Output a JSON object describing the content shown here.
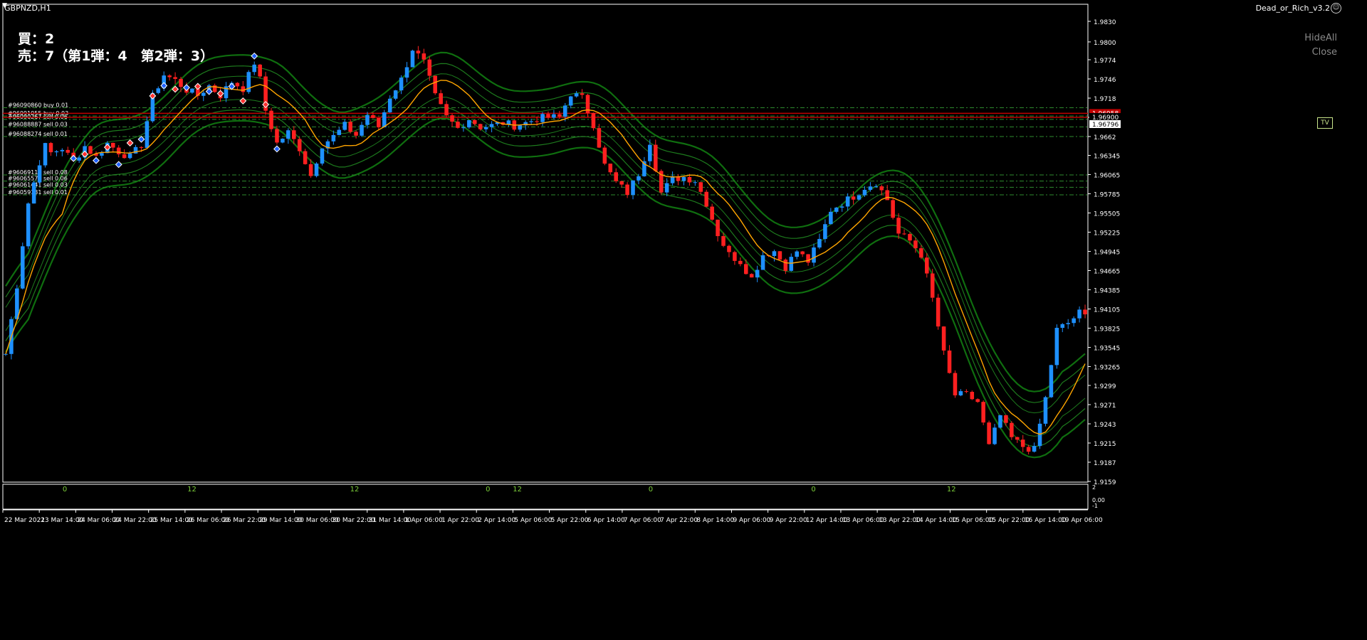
{
  "window": {
    "symbol_title": "GBPNZD,H1",
    "ea_title": "Dead_or_Rich_v3.2",
    "ea_icon": "☺"
  },
  "positions": {
    "buy_summary": "買：2",
    "sell_summary": "売：7（第1弾：4　第2弾：3）"
  },
  "buttons": {
    "hide_all": "HideAll",
    "close": "Close",
    "tv": "TV"
  },
  "chart_data": {
    "type": "candlestick",
    "symbol": "GBPNZD",
    "timeframe": "H1",
    "price_axis_ticks": [
      1.983,
      1.98,
      1.9774,
      1.9746,
      1.9718,
      1.969,
      1.9662,
      1.96345,
      1.96065,
      1.95785,
      1.95505,
      1.95225,
      1.94945,
      1.94665,
      1.94385,
      1.94105,
      1.93825,
      1.93545,
      1.93265,
      1.9299,
      1.9271,
      1.9243,
      1.9215,
      1.9187,
      1.9159
    ],
    "time_axis_labels": [
      "22 Mar 2021",
      "23 Mar 14:00",
      "24 Mar 06:00",
      "24 Mar 22:00",
      "25 Mar 14:00",
      "26 Mar 06:00",
      "26 Mar 22:00",
      "29 Mar 14:00",
      "30 Mar 06:00",
      "30 Mar 22:00",
      "31 Mar 14:00",
      "1 Apr 06:00",
      "1 Apr 22:00",
      "2 Apr 14:00",
      "5 Apr 06:00",
      "5 Apr 22:00",
      "6 Apr 14:00",
      "7 Apr 06:00",
      "7 Apr 22:00",
      "8 Apr 14:00",
      "9 Apr 06:00",
      "9 Apr 22:00",
      "12 Apr 14:00",
      "13 Apr 06:00",
      "13 Apr 22:00",
      "14 Apr 14:00",
      "15 Apr 06:00",
      "15 Apr 22:00",
      "16 Apr 14:00",
      "19 Apr 06:00"
    ],
    "price_labels": {
      "bid": "1.96796",
      "level_upper": "1.96958",
      "level_lower": "1.96900"
    },
    "order_lines": [
      {
        "label": "#96090860 buy 0.01",
        "price": 1.9704
      },
      {
        "label": "#96091055 buy 0.03",
        "price": 1.9692
      },
      {
        "label": "#96090267 sell 0.06",
        "price": 1.9687
      },
      {
        "label": "#96088887 sell 0.03",
        "price": 1.9676
      },
      {
        "label": "#96088274 sell 0.01",
        "price": 1.9662
      },
      {
        "label": "#96069117 sell 0.08",
        "price": 1.9606
      },
      {
        "label": "#96065571 sell 0.06",
        "price": 1.9597
      },
      {
        "label": "#96061441 sell 0.03",
        "price": 1.9588
      },
      {
        "label": "#96059131 sell 0.01",
        "price": 1.9577
      }
    ],
    "price_path": [
      [
        0,
        1.9345
      ],
      [
        2,
        1.9445
      ],
      [
        4,
        1.9565
      ],
      [
        6,
        1.9625
      ],
      [
        7,
        1.9648
      ],
      [
        8,
        1.9638
      ],
      [
        10,
        1.9645
      ],
      [
        12,
        1.9625
      ],
      [
        14,
        1.9648
      ],
      [
        16,
        1.9632
      ],
      [
        18,
        1.9652
      ],
      [
        20,
        1.964
      ],
      [
        22,
        1.9632
      ],
      [
        24,
        1.965
      ],
      [
        26,
        1.972
      ],
      [
        28,
        1.9752
      ],
      [
        30,
        1.9744
      ],
      [
        32,
        1.973
      ],
      [
        34,
        1.9722
      ],
      [
        36,
        1.9736
      ],
      [
        38,
        1.9722
      ],
      [
        40,
        1.9742
      ],
      [
        42,
        1.9732
      ],
      [
        44,
        1.977
      ],
      [
        45,
        1.9745
      ],
      [
        46,
        1.97
      ],
      [
        48,
        1.9652
      ],
      [
        50,
        1.9668
      ],
      [
        52,
        1.9645
      ],
      [
        54,
        1.9605
      ],
      [
        56,
        1.965
      ],
      [
        58,
        1.9662
      ],
      [
        60,
        1.9678
      ],
      [
        62,
        1.9664
      ],
      [
        64,
        1.9694
      ],
      [
        66,
        1.9676
      ],
      [
        68,
        1.972
      ],
      [
        70,
        1.9745
      ],
      [
        72,
        1.979
      ],
      [
        74,
        1.977
      ],
      [
        76,
        1.972
      ],
      [
        78,
        1.969
      ],
      [
        80,
        1.9674
      ],
      [
        82,
        1.9688
      ],
      [
        84,
        1.9676
      ],
      [
        86,
        1.9678
      ],
      [
        88,
        1.9682
      ],
      [
        90,
        1.9678
      ],
      [
        92,
        1.9682
      ],
      [
        94,
        1.9688
      ],
      [
        96,
        1.969
      ],
      [
        98,
        1.969
      ],
      [
        100,
        1.9725
      ],
      [
        102,
        1.9718
      ],
      [
        104,
        1.968
      ],
      [
        106,
        1.962
      ],
      [
        108,
        1.9595
      ],
      [
        110,
        1.958
      ],
      [
        112,
        1.9608
      ],
      [
        114,
        1.9655
      ],
      [
        116,
        1.958
      ],
      [
        118,
        1.96
      ],
      [
        120,
        1.9603
      ],
      [
        122,
        1.9598
      ],
      [
        124,
        1.9565
      ],
      [
        126,
        1.952
      ],
      [
        128,
        1.949
      ],
      [
        130,
        1.948
      ],
      [
        132,
        1.9455
      ],
      [
        134,
        1.949
      ],
      [
        136,
        1.9495
      ],
      [
        138,
        1.9472
      ],
      [
        140,
        1.9495
      ],
      [
        142,
        1.948
      ],
      [
        144,
        1.951
      ],
      [
        146,
        1.9555
      ],
      [
        148,
        1.9565
      ],
      [
        150,
        1.9575
      ],
      [
        152,
        1.9588
      ],
      [
        154,
        1.9595
      ],
      [
        156,
        1.957
      ],
      [
        158,
        1.952
      ],
      [
        160,
        1.951
      ],
      [
        162,
        1.949
      ],
      [
        164,
        1.9425
      ],
      [
        166,
        1.9345
      ],
      [
        168,
        1.9285
      ],
      [
        170,
        1.9285
      ],
      [
        172,
        1.9275
      ],
      [
        174,
        1.921
      ],
      [
        176,
        1.9255
      ],
      [
        178,
        1.9222
      ],
      [
        180,
        1.921
      ],
      [
        182,
        1.9205
      ],
      [
        184,
        1.928
      ],
      [
        186,
        1.938
      ],
      [
        188,
        1.939
      ],
      [
        190,
        1.9405
      ],
      [
        191,
        1.94
      ]
    ],
    "overlays": [
      "moving-average-orange",
      "bands-green-inner",
      "bands-green-outer",
      "entry-markers",
      "order-lines"
    ],
    "sub_indicator_labels": [
      {
        "text": "0"
      },
      {
        "text": "12"
      },
      {
        "text": "12"
      },
      {
        "text": "0"
      },
      {
        "text": "12"
      },
      {
        "text": "0"
      },
      {
        "text": "0"
      },
      {
        "text": "12"
      }
    ],
    "sub_axis_ticks": [
      "2",
      "0.00",
      "-1"
    ],
    "colors": {
      "bull": "#1e90ff",
      "bear": "#ff2020",
      "ma": "#ffa500",
      "band": "#1d7a1d",
      "band_outer": "#0f6e0f",
      "order_line": "#2e8b2e",
      "red_line": "#c00000",
      "axis_text": "#ffffff"
    }
  }
}
